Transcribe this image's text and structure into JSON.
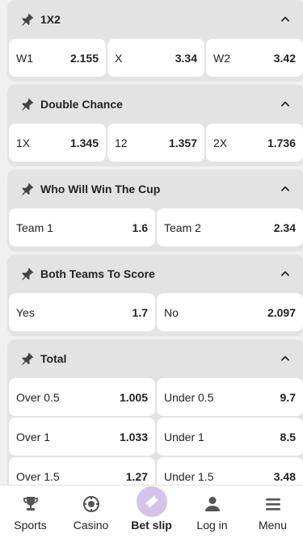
{
  "markets": [
    {
      "title": "1X2",
      "rows": [
        [
          {
            "label": "W1",
            "value": "2.155"
          },
          {
            "label": "X",
            "value": "3.34"
          },
          {
            "label": "W2",
            "value": "3.42"
          }
        ]
      ]
    },
    {
      "title": "Double Chance",
      "rows": [
        [
          {
            "label": "1X",
            "value": "1.345"
          },
          {
            "label": "12",
            "value": "1.357"
          },
          {
            "label": "2X",
            "value": "1.736"
          }
        ]
      ]
    },
    {
      "title": "Who Will Win The Cup",
      "rows": [
        [
          {
            "label": "Team 1",
            "value": "1.6"
          },
          {
            "label": "Team 2",
            "value": "2.34"
          }
        ]
      ]
    },
    {
      "title": "Both Teams To Score",
      "rows": [
        [
          {
            "label": "Yes",
            "value": "1.7"
          },
          {
            "label": "No",
            "value": "2.097"
          }
        ]
      ]
    },
    {
      "title": "Total",
      "rows": [
        [
          {
            "label": "Over 0.5",
            "value": "1.005"
          },
          {
            "label": "Under 0.5",
            "value": "9.7"
          }
        ],
        [
          {
            "label": "Over 1",
            "value": "1.033"
          },
          {
            "label": "Under 1",
            "value": "8.5"
          }
        ],
        [
          {
            "label": "Over 1.5",
            "value": "1.27"
          },
          {
            "label": "Under 1.5",
            "value": "3.48"
          }
        ]
      ]
    }
  ],
  "nav": [
    {
      "label": "Sports",
      "icon": "trophy-icon"
    },
    {
      "label": "Casino",
      "icon": "casino-chip-icon"
    },
    {
      "label": "Bet slip",
      "icon": "ticket-icon",
      "active": true
    },
    {
      "label": "Log in",
      "icon": "user-icon"
    },
    {
      "label": "Menu",
      "icon": "menu-icon"
    }
  ],
  "colors": {
    "accent": "#d6c3ec",
    "card": "#e3e3e3",
    "background": "#f0f0f0"
  }
}
